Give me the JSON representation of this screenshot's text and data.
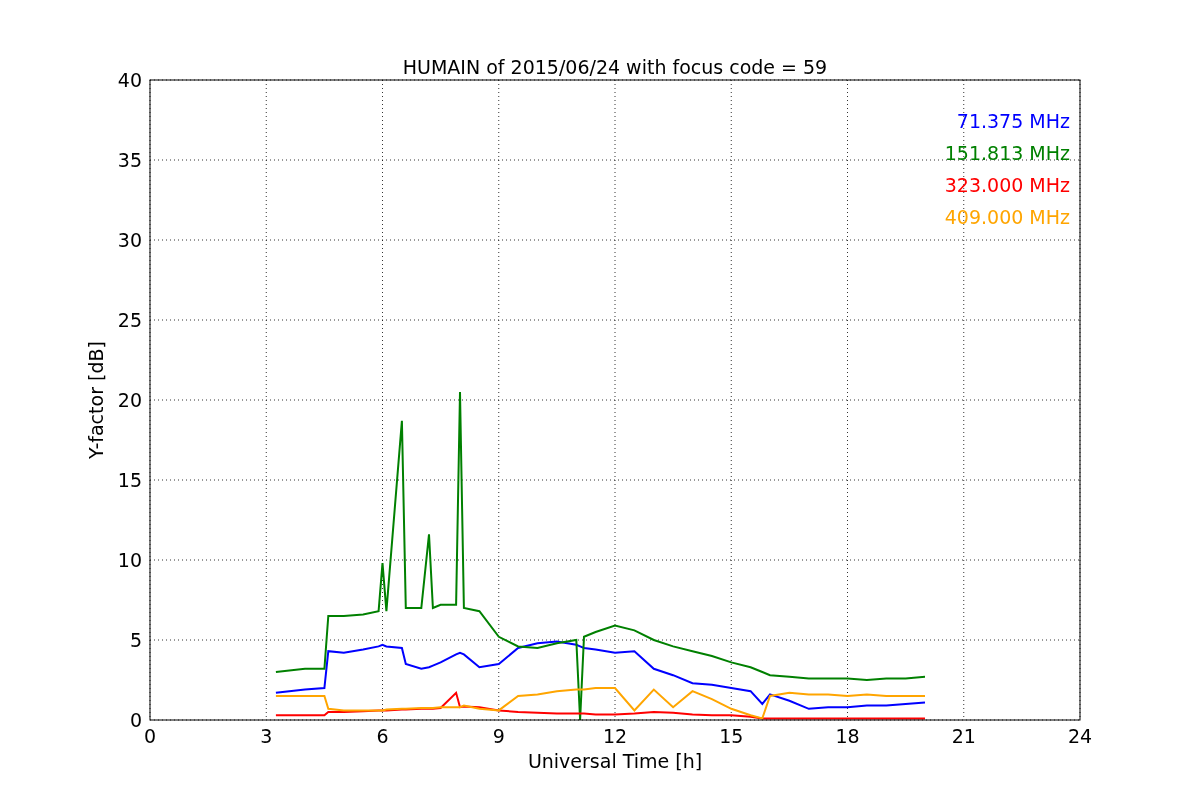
{
  "chart_data": {
    "type": "line",
    "title": "HUMAIN of 2015/06/24 with focus code = 59",
    "xlabel": "Universal Time [h]",
    "ylabel": "Y-factor [dB]",
    "grid": true,
    "xlim": [
      0,
      24
    ],
    "ylim": [
      0,
      40
    ],
    "xticks": [
      0,
      3,
      6,
      9,
      12,
      15,
      18,
      21,
      24
    ],
    "yticks": [
      0,
      5,
      10,
      15,
      20,
      25,
      30,
      35,
      40
    ],
    "x": [
      3.25,
      4,
      4.5,
      4.6,
      5,
      5.5,
      5.9,
      6,
      6.1,
      6.5,
      6.6,
      7,
      7.2,
      7.3,
      7.5,
      7.9,
      8,
      8.1,
      8.5,
      9,
      9.5,
      10,
      10.5,
      11,
      11.1,
      11.2,
      11.5,
      12,
      12.5,
      13,
      13.5,
      14,
      14.5,
      15,
      15.5,
      15.8,
      16,
      16.5,
      17,
      17.5,
      18,
      18.5,
      19,
      19.5,
      20
    ],
    "series": [
      {
        "name": "71.375 MHz",
        "color": "#0000ff",
        "values": [
          1.7,
          1.9,
          2.0,
          4.3,
          4.2,
          4.4,
          4.6,
          4.7,
          4.6,
          4.5,
          3.5,
          3.2,
          3.3,
          3.4,
          3.6,
          4.1,
          4.2,
          4.1,
          3.3,
          3.5,
          4.5,
          4.8,
          4.9,
          4.7,
          4.6,
          4.5,
          4.4,
          4.2,
          4.3,
          3.2,
          2.8,
          2.3,
          2.2,
          2.0,
          1.8,
          1.0,
          1.6,
          1.2,
          0.7,
          0.8,
          0.8,
          0.9,
          0.9,
          1.0,
          1.1
        ]
      },
      {
        "name": "151.813 MHz",
        "color": "#008000",
        "values": [
          3.0,
          3.2,
          3.2,
          6.5,
          6.5,
          6.6,
          6.8,
          9.8,
          6.8,
          18.7,
          7.0,
          7.0,
          11.6,
          7.0,
          7.2,
          7.2,
          20.5,
          7.0,
          6.8,
          5.2,
          4.6,
          4.5,
          4.8,
          5.0,
          0.0,
          5.2,
          5.5,
          5.9,
          5.6,
          5.0,
          4.6,
          4.3,
          4.0,
          3.6,
          3.3,
          3.0,
          2.8,
          2.7,
          2.6,
          2.6,
          2.6,
          2.5,
          2.6,
          2.6,
          2.7
        ]
      },
      {
        "name": "323.000 MHz",
        "color": "#ff0000",
        "values": [
          0.3,
          0.3,
          0.3,
          0.5,
          0.5,
          0.55,
          0.6,
          0.6,
          0.6,
          0.65,
          0.65,
          0.7,
          0.7,
          0.7,
          0.75,
          1.7,
          0.8,
          0.85,
          0.8,
          0.6,
          0.5,
          0.45,
          0.4,
          0.4,
          0.4,
          0.4,
          0.35,
          0.35,
          0.4,
          0.5,
          0.45,
          0.35,
          0.3,
          0.3,
          0.2,
          0.1,
          0.1,
          0.1,
          0.1,
          0.1,
          0.1,
          0.1,
          0.1,
          0.1,
          0.1
        ]
      },
      {
        "name": "409.000 MHz",
        "color": "#ffa500",
        "values": [
          1.5,
          1.5,
          1.5,
          0.7,
          0.6,
          0.6,
          0.6,
          0.6,
          0.65,
          0.7,
          0.7,
          0.75,
          0.75,
          0.75,
          0.8,
          0.8,
          0.8,
          0.9,
          0.7,
          0.6,
          1.5,
          1.6,
          1.8,
          1.9,
          1.9,
          1.9,
          2.0,
          2.0,
          0.6,
          1.9,
          0.8,
          1.8,
          1.3,
          0.7,
          0.3,
          0.1,
          1.5,
          1.7,
          1.6,
          1.6,
          1.5,
          1.6,
          1.5,
          1.5,
          1.5
        ]
      }
    ]
  }
}
